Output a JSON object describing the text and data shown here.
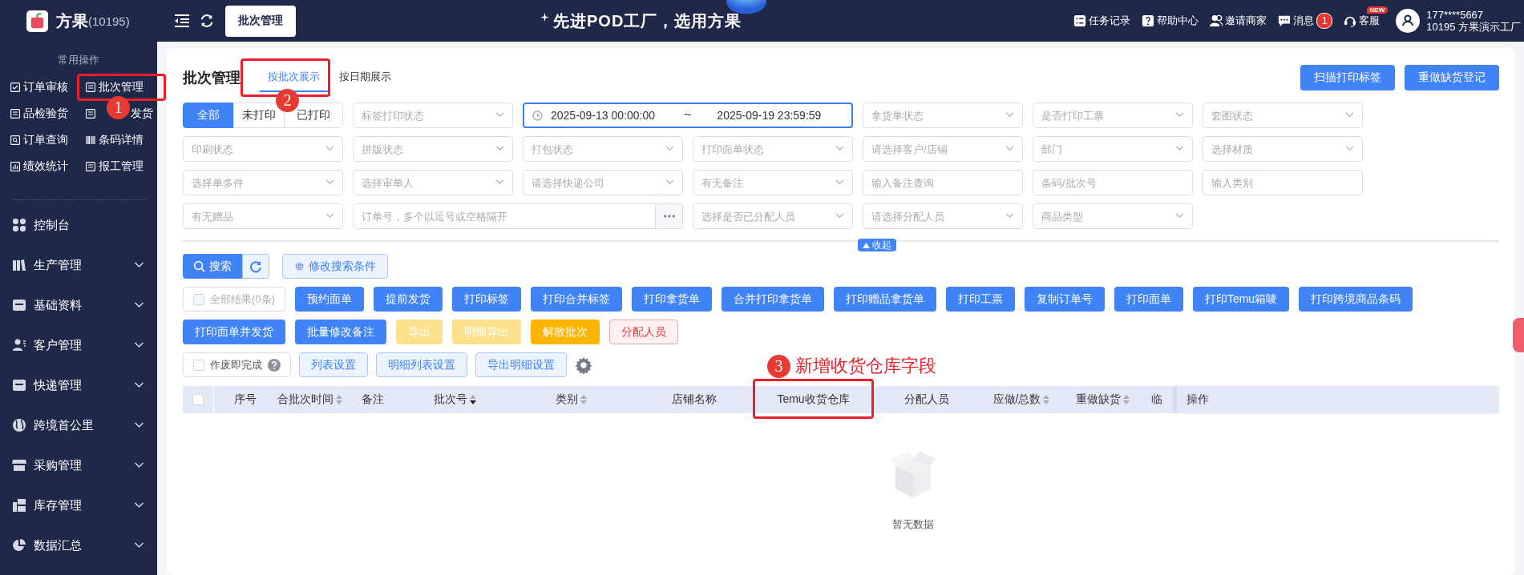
{
  "brand": {
    "name": "方果",
    "code": "(10195)"
  },
  "header": {
    "open_tab": "批次管理",
    "slogan": "先进POD工厂，选用方果",
    "links": [
      {
        "label": "任务记录",
        "kind": "tasks"
      },
      {
        "label": "帮助中心",
        "kind": "help"
      },
      {
        "label": "邀请商家",
        "kind": "invite"
      },
      {
        "label": "消息",
        "kind": "messages",
        "count": "1"
      },
      {
        "label": "客服",
        "kind": "service",
        "tag": "NEW"
      }
    ],
    "user": {
      "phone": "177****5667",
      "org": "10195  方果演示工厂"
    }
  },
  "sidebar": {
    "quick_title": "常用操作",
    "quick_items": [
      {
        "label": "订单审核",
        "kind": "check"
      },
      {
        "label": "批次管理",
        "kind": "batch",
        "annotation": "1"
      },
      {
        "label": "品检验货",
        "kind": "inspect"
      },
      {
        "label": "发货",
        "kind": "ship",
        "covered": true
      },
      {
        "label": "订单查询",
        "kind": "search"
      },
      {
        "label": "条码详情",
        "kind": "barcode"
      },
      {
        "label": "绩效统计",
        "kind": "chart"
      },
      {
        "label": "报工管理",
        "kind": "report"
      }
    ],
    "menu": [
      {
        "label": "控制台",
        "kind": "dashboard"
      },
      {
        "label": "生产管理",
        "kind": "production",
        "expanded": false
      },
      {
        "label": "基础资料",
        "kind": "base",
        "expanded": false
      },
      {
        "label": "客户管理",
        "kind": "customer",
        "expanded": false
      },
      {
        "label": "快递管理",
        "kind": "express",
        "expanded": false
      },
      {
        "label": "跨境首公里",
        "kind": "globe",
        "expanded": false
      },
      {
        "label": "采购管理",
        "kind": "store",
        "expanded": false
      },
      {
        "label": "库存管理",
        "kind": "stock",
        "expanded": false
      },
      {
        "label": "数据汇总",
        "kind": "pie",
        "expanded": false
      }
    ]
  },
  "page": {
    "title": "批次管理",
    "view_tabs": [
      {
        "label": "按批次展示",
        "selected": true,
        "annotation": "2"
      },
      {
        "label": "按日期展示",
        "selected": false
      }
    ],
    "top_buttons": [
      "扫描打印标签",
      "重做缺货登记"
    ],
    "filters": [
      {
        "kind": "segmented",
        "options": [
          {
            "label": "全部",
            "selected": true
          },
          {
            "label": "未打印",
            "selected": false
          },
          {
            "label": "已打印",
            "selected": false
          }
        ]
      },
      {
        "kind": "select",
        "placeholder": "标签打印状态"
      },
      {
        "kind": "date_range",
        "start": "2025-09-13 00:00:00",
        "separator": "~",
        "end": "2025-09-19 23:59:59",
        "focused": true
      },
      {
        "kind": "select",
        "placeholder": "拿货单状态"
      },
      {
        "kind": "select",
        "placeholder": "是否打印工票"
      },
      {
        "kind": "select",
        "placeholder": "套图状态"
      },
      {
        "kind": "select",
        "placeholder": "印刷状态"
      },
      {
        "kind": "select",
        "placeholder": "拼版状态"
      },
      {
        "kind": "select",
        "placeholder": "打包状态"
      },
      {
        "kind": "select",
        "placeholder": "打印面单状态"
      },
      {
        "kind": "select",
        "placeholder": "请选择客户/店铺"
      },
      {
        "kind": "select",
        "placeholder": "部门"
      },
      {
        "kind": "select",
        "placeholder": "选择材质"
      },
      {
        "kind": "select",
        "placeholder": "选择单多件"
      },
      {
        "kind": "select",
        "placeholder": "选择审单人"
      },
      {
        "kind": "select",
        "placeholder": "请选择快递公司"
      },
      {
        "kind": "select",
        "placeholder": "有无备注"
      },
      {
        "kind": "input",
        "placeholder": "输入备注查询"
      },
      {
        "kind": "input",
        "placeholder": "条码/批次号"
      },
      {
        "kind": "input",
        "placeholder": "输入类别"
      },
      {
        "kind": "select",
        "placeholder": "有无赠品"
      },
      {
        "kind": "multi_input",
        "placeholder": "订单号，多个以逗号或空格隔开"
      },
      {
        "kind": "select",
        "placeholder": "选择是否已分配人员"
      },
      {
        "kind": "select",
        "placeholder": "请选择分配人员"
      },
      {
        "kind": "select",
        "placeholder": "商品类型"
      }
    ],
    "collapse": "收起",
    "search_button": "搜索",
    "edit_conditions": "修改搜索条件",
    "all_results": {
      "label": "全部结果(0条)",
      "checked": false,
      "disabled": true
    },
    "actions": [
      {
        "label": "预约面单",
        "kind": "primary"
      },
      {
        "label": "提前发货",
        "kind": "primary"
      },
      {
        "label": "打印标签",
        "kind": "primary"
      },
      {
        "label": "打印合并标签",
        "kind": "primary"
      },
      {
        "label": "打印拿货单",
        "kind": "primary"
      },
      {
        "label": "合并打印拿货单",
        "kind": "primary"
      },
      {
        "label": "打印赠品拿货单",
        "kind": "primary"
      },
      {
        "label": "打印工票",
        "kind": "primary"
      },
      {
        "label": "复制订单号",
        "kind": "primary"
      },
      {
        "label": "打印面单",
        "kind": "primary"
      },
      {
        "label": "打印Temu箱唛",
        "kind": "primary"
      },
      {
        "label": "打印跨境商品条码",
        "kind": "primary"
      },
      {
        "label": "打印面单并发货",
        "kind": "primary"
      },
      {
        "label": "批量修改备注",
        "kind": "primary"
      },
      {
        "label": "导出",
        "kind": "warning_light"
      },
      {
        "label": "明细导出",
        "kind": "warning_light"
      },
      {
        "label": "解散批次",
        "kind": "warning"
      },
      {
        "label": "分配人员",
        "kind": "danger_plain"
      }
    ],
    "void_complete": {
      "label": "作废即完成",
      "checked": false
    },
    "settings_buttons": [
      "列表设置",
      "明细列表设置",
      "导出明细设置"
    ],
    "table": {
      "select_all_checked": false,
      "columns": [
        {
          "label": "序号",
          "sortable": false
        },
        {
          "label": "合批次时间",
          "sortable": true,
          "sorted_desc": false
        },
        {
          "label": "备注",
          "sortable": false
        },
        {
          "label": "批次号",
          "sortable": true,
          "sorted_desc": true
        },
        {
          "label": "类别",
          "sortable": true,
          "sorted_desc": false
        },
        {
          "label": "店铺名称",
          "sortable": false
        },
        {
          "label": "Temu收货仓库",
          "sortable": false,
          "annotation": "3",
          "note": "新增收货仓库字段"
        },
        {
          "label": "分配人员",
          "sortable": false
        },
        {
          "label": "应做/总数",
          "sortable": true,
          "sorted_desc": false
        },
        {
          "label": "重做缺货",
          "sortable": true,
          "sorted_desc": false
        },
        {
          "label": "临",
          "sortable": false
        }
      ],
      "fixed_column": "操作",
      "empty_text": "暂无数据"
    }
  }
}
